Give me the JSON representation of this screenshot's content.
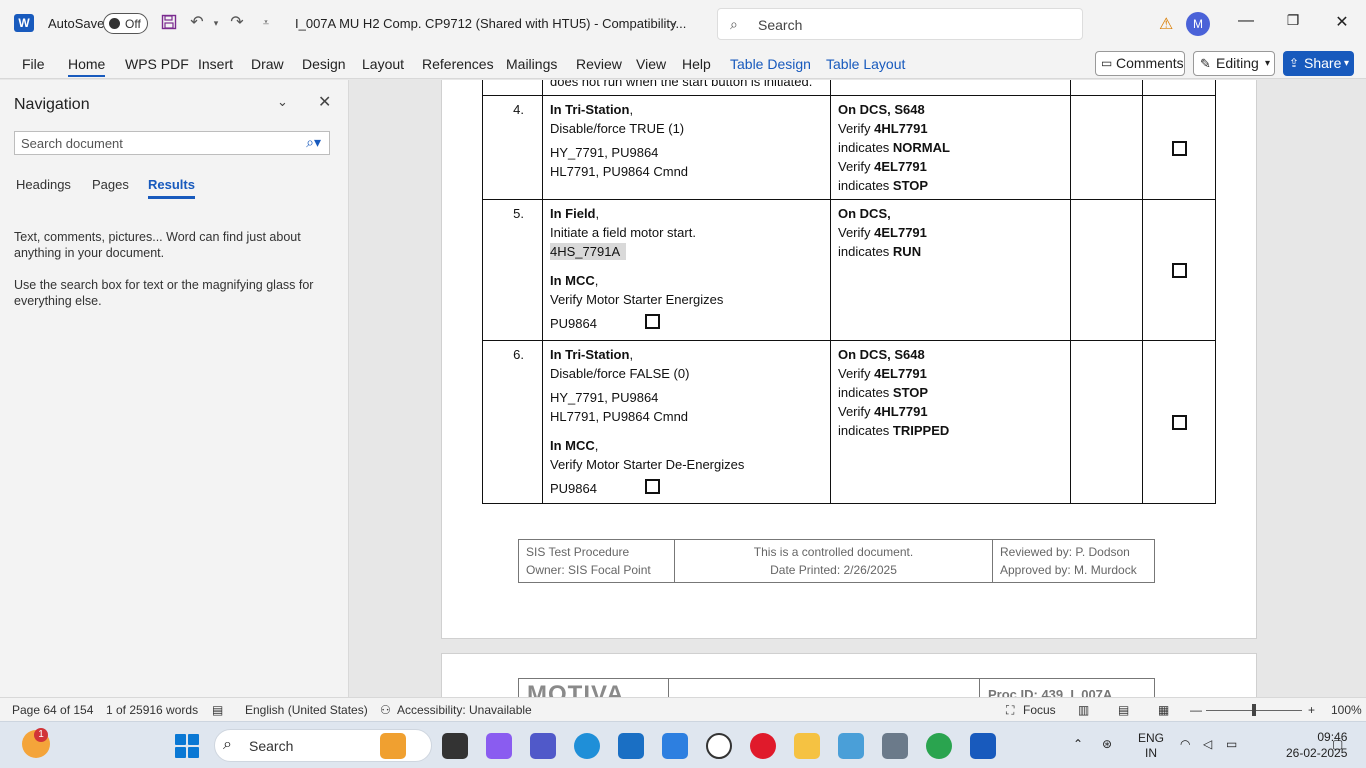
{
  "titlebar": {
    "app_initial": "W",
    "autosave_label": "AutoSave",
    "autosave_state": "Off",
    "doc_title": "I_007A MU H2 Comp. CP9712 (Shared with HTU5)  -  Compatibility...",
    "search_placeholder": "Search",
    "avatar_initial": "M"
  },
  "ribbon": {
    "tabs": [
      "File",
      "Home",
      "WPS PDF",
      "Insert",
      "Draw",
      "Design",
      "Layout",
      "References",
      "Mailings",
      "Review",
      "View",
      "Help",
      "Table Design",
      "Table Layout"
    ],
    "comments_label": "Comments",
    "editing_label": "Editing",
    "share_label": "Share"
  },
  "navigation": {
    "title": "Navigation",
    "search_placeholder": "Search document",
    "tabs": [
      "Headings",
      "Pages",
      "Results"
    ],
    "hint1": "Text, comments, pictures... Word can find just about anything in your document.",
    "hint2": "Use the search box for text or the magnifying glass for everything else."
  },
  "document": {
    "prev_row_text": "does not run when the start button is initiated.",
    "rows": [
      {
        "num": "4.",
        "action": {
          "l1_bold": "In Tri-Station",
          "l1_rest": ",",
          "l2": "Disable/force TRUE (1)",
          "l3": "HY_7791, PU9864",
          "l4": "HL7791, PU9864 Cmnd"
        },
        "expected": {
          "l1_bold": "On DCS, S648",
          "l2_pre": "Verify ",
          "l2_bold": "4HL7791",
          "l3_pre": " indicates ",
          "l3_bold": "NORMAL",
          "l4_pre": "Verify ",
          "l4_bold": "4EL7791",
          "l5_pre": " indicates ",
          "l5_bold": "STOP"
        }
      },
      {
        "num": "5.",
        "action": {
          "l1_bold": "In Field",
          "l1_rest": ",",
          "l2": "Initiate a field motor start.",
          "l3_highlight": "4HS_7791A",
          "l4_bold": "In MCC",
          "l4_rest": ",",
          "l5": "Verify Motor Starter Energizes",
          "l6": "PU9864"
        },
        "expected": {
          "l1_bold": "On DCS,",
          "l2_pre": "Verify ",
          "l2_bold": "4EL7791",
          "l3_pre": " indicates ",
          "l3_bold": "RUN"
        }
      },
      {
        "num": "6.",
        "action": {
          "l1_bold": "In Tri-Station",
          "l1_rest": ",",
          "l2": "Disable/force FALSE (0)",
          "l3": "HY_7791, PU9864",
          "l4": "HL7791, PU9864 Cmnd",
          "l5_bold": "In MCC",
          "l5_rest": ",",
          "l6": "Verify Motor Starter De-Energizes",
          "l7": "PU9864"
        },
        "expected": {
          "l1_bold": "On DCS, S648",
          "l2_pre": "Verify ",
          "l2_bold": "4EL7791",
          "l3_pre": " indicates ",
          "l3_bold": "STOP",
          "l4_pre": "Verify ",
          "l4_bold": "4HL7791",
          "l5_pre": " indicates ",
          "l5_bold": "TRIPPED"
        }
      }
    ],
    "footer": {
      "left1": "SIS Test Procedure",
      "left2": "Owner: SIS Focal Point",
      "mid1": "This is a controlled document.",
      "mid2": "Date Printed: 2/26/2025",
      "right1": "Reviewed by: P. Dodson",
      "right2": "Approved by: M. Murdock"
    },
    "page2": {
      "logo_text": "MOTIVA",
      "proc_id": "Proc ID: 439_I_007A"
    }
  },
  "statusbar": {
    "page": "Page 64 of 154",
    "words": "1 of 25916 words",
    "language": "English (United States)",
    "accessibility": "Accessibility: Unavailable",
    "focus": "Focus",
    "zoom": "100%"
  },
  "taskbar": {
    "search_label": "Search",
    "weather_badge": "1",
    "lang1": "ENG",
    "lang2": "IN",
    "time": "09:46",
    "date": "26-02-2025"
  },
  "colors": {
    "word_blue": "#185abd",
    "accent_warning": "#d97c00"
  }
}
